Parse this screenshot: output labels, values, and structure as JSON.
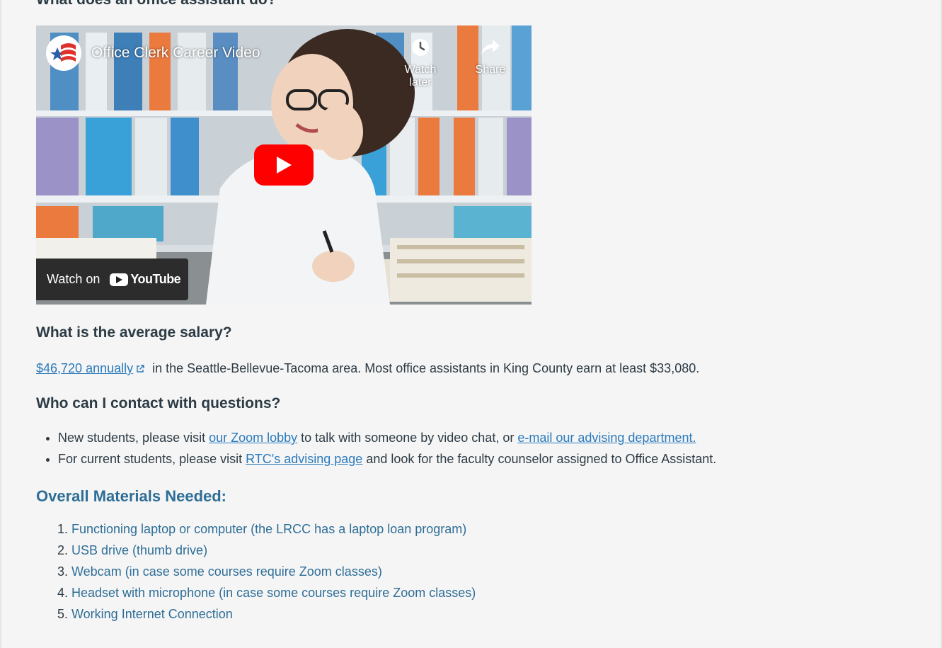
{
  "headings": {
    "office_assistant": "What does an office assistant do?",
    "salary": "What is the average salary?",
    "contact": "Who can I contact with questions?",
    "materials": "Overall Materials Needed:"
  },
  "video": {
    "title": "Office Clerk Career Video",
    "watch_later": "Watch later",
    "share": "Share",
    "watch_on": "Watch on",
    "youtube": "YouTube"
  },
  "salary": {
    "link_text": "$46,720 annually",
    "rest": " in the Seattle-Bellevue-Tacoma area. Most office assistants in King County earn at least $33,080."
  },
  "contact": {
    "item1_pre": "New students, please visit ",
    "item1_link1": "our Zoom lobby",
    "item1_mid": " to talk with someone by video chat, or ",
    "item1_link2": "e-mail our advising department.",
    "item2_pre": "For current students, please visit ",
    "item2_link": "RTC's advising page",
    "item2_post": " and look for the faculty counselor assigned to Office Assistant."
  },
  "materials": [
    "Functioning laptop or computer (the LRCC has a laptop loan program)",
    "USB drive (thumb drive)",
    "Webcam (in case some courses require Zoom classes)",
    "Headset with microphone (in case some courses require Zoom classes)",
    "Working Internet Connection"
  ],
  "colors": {
    "link": "#2b7abc",
    "materials": "#2e6e97",
    "text": "#2d3b45",
    "youtube_red": "#ff0000"
  }
}
